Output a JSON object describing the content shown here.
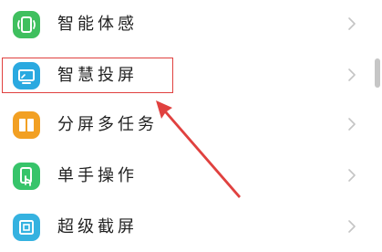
{
  "settings_list": {
    "items": [
      {
        "label": "智能体感",
        "icon": "phone-motion-icon",
        "icon_color": "#3fbf5e"
      },
      {
        "label": "智慧投屏",
        "icon": "screen-cast-icon",
        "icon_color": "#2aa9e0"
      },
      {
        "label": "分屏多任务",
        "icon": "split-screen-icon",
        "icon_color": "#f2a023"
      },
      {
        "label": "单手操作",
        "icon": "one-hand-icon",
        "icon_color": "#37c46a"
      },
      {
        "label": "超级截屏",
        "icon": "screenshot-icon",
        "icon_color": "#35b2e0"
      }
    ]
  },
  "annotation": {
    "highlight_color": "#e0413f",
    "highlighted_item": "智慧投屏"
  }
}
